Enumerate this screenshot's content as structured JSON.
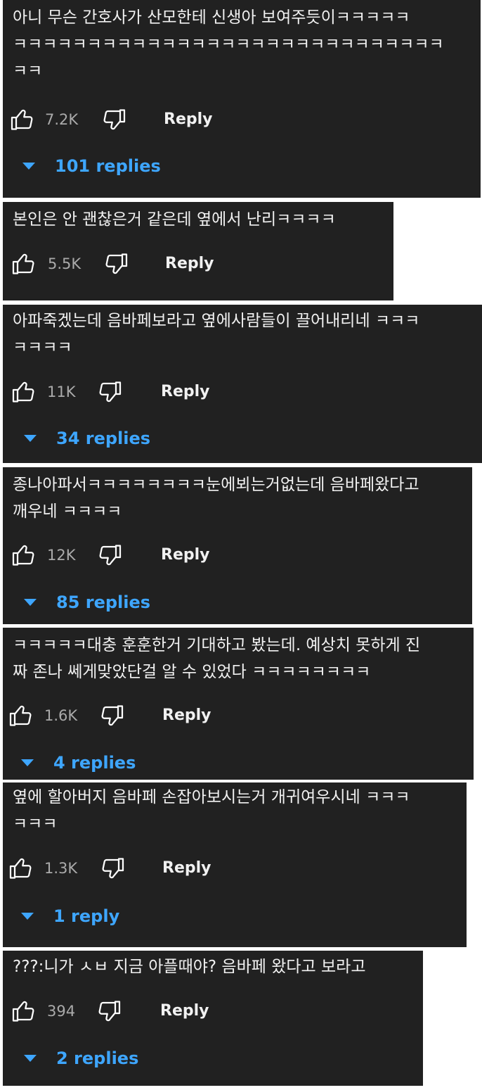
{
  "ui": {
    "reply_label": "Reply",
    "accent_color": "#3ea6ff",
    "card_color": "#212121"
  },
  "comments": [
    {
      "text": "아니 무슨 간호사가 산모한테 신생아 보여주듯이ㅋㅋㅋㅋㅋ\nㅋㅋㅋㅋㅋㅋㅋㅋㅋㅋㅋㅋㅋㅋㅋㅋㅋㅋㅋㅋㅋㅋㅋㅋㅋㅋㅋㅋㅋ\nㅋㅋ",
      "likes": "7.2K",
      "replies": "101 replies"
    },
    {
      "text": "본인은 안 괜찮은거 같은데 옆에서 난리ㅋㅋㅋㅋ",
      "likes": "5.5K",
      "replies": ""
    },
    {
      "text": "아파죽겠는데 음바페보라고 옆에사람들이 끌어내리네 ㅋㅋㅋ\nㅋㅋㅋㅋ",
      "likes": "11K",
      "replies": "34 replies"
    },
    {
      "text": "종나아파서ㅋㅋㅋㅋㅋㅋㅋㅋ눈에뵈는거없는데 음바페왔다고\n깨우네 ㅋㅋㅋㅋ",
      "likes": "12K",
      "replies": "85 replies"
    },
    {
      "text": "ㅋㅋㅋㅋㅋ대충 훈훈한거 기대하고 봤는데. 예상치 못하게 진\n짜 존나 쎄게맞았단걸 알 수 있었다 ㅋㅋㅋㅋㅋㅋㅋㅋ",
      "likes": "1.6K",
      "replies": "4 replies"
    },
    {
      "text": "옆에 할아버지 음바페 손잡아보시는거 개귀여우시네 ㅋㅋㅋ\nㅋㅋㅋ",
      "likes": "1.3K",
      "replies": "1 reply"
    },
    {
      "text": "???:니가 ㅅㅂ 지금 아플때야? 음바페 왔다고 보라고",
      "likes": "394",
      "replies": "2 replies"
    }
  ]
}
